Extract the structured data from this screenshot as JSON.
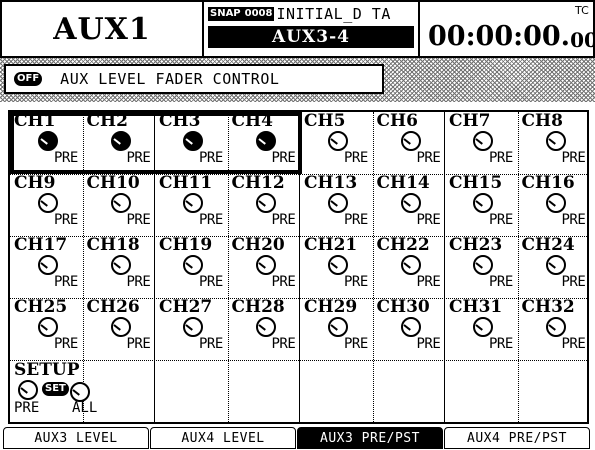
{
  "header": {
    "title": "AUX1",
    "snap_badge": "SNAP",
    "scene_number": "0008",
    "scene_name": "INITIAL_D TA",
    "aux_pair": "AUX3-4",
    "tc_label": "TC",
    "timecode": "00:00:00.",
    "timecode_frames": "00"
  },
  "fader_control": {
    "off_badge": "OFF",
    "label": "AUX LEVEL FADER CONTROL"
  },
  "channels": [
    {
      "name": "CH1",
      "pre": "PRE",
      "active": true
    },
    {
      "name": "CH2",
      "pre": "PRE",
      "active": true
    },
    {
      "name": "CH3",
      "pre": "PRE",
      "active": true
    },
    {
      "name": "CH4",
      "pre": "PRE",
      "active": true
    },
    {
      "name": "CH5",
      "pre": "PRE",
      "active": false
    },
    {
      "name": "CH6",
      "pre": "PRE",
      "active": false
    },
    {
      "name": "CH7",
      "pre": "PRE",
      "active": false
    },
    {
      "name": "CH8",
      "pre": "PRE",
      "active": false
    },
    {
      "name": "CH9",
      "pre": "PRE",
      "active": false
    },
    {
      "name": "CH10",
      "pre": "PRE",
      "active": false
    },
    {
      "name": "CH11",
      "pre": "PRE",
      "active": false
    },
    {
      "name": "CH12",
      "pre": "PRE",
      "active": false
    },
    {
      "name": "CH13",
      "pre": "PRE",
      "active": false
    },
    {
      "name": "CH14",
      "pre": "PRE",
      "active": false
    },
    {
      "name": "CH15",
      "pre": "PRE",
      "active": false
    },
    {
      "name": "CH16",
      "pre": "PRE",
      "active": false
    },
    {
      "name": "CH17",
      "pre": "PRE",
      "active": false
    },
    {
      "name": "CH18",
      "pre": "PRE",
      "active": false
    },
    {
      "name": "CH19",
      "pre": "PRE",
      "active": false
    },
    {
      "name": "CH20",
      "pre": "PRE",
      "active": false
    },
    {
      "name": "CH21",
      "pre": "PRE",
      "active": false
    },
    {
      "name": "CH22",
      "pre": "PRE",
      "active": false
    },
    {
      "name": "CH23",
      "pre": "PRE",
      "active": false
    },
    {
      "name": "CH24",
      "pre": "PRE",
      "active": false
    },
    {
      "name": "CH25",
      "pre": "PRE",
      "active": false
    },
    {
      "name": "CH26",
      "pre": "PRE",
      "active": false
    },
    {
      "name": "CH27",
      "pre": "PRE",
      "active": false
    },
    {
      "name": "CH28",
      "pre": "PRE",
      "active": false
    },
    {
      "name": "CH29",
      "pre": "PRE",
      "active": false
    },
    {
      "name": "CH30",
      "pre": "PRE",
      "active": false
    },
    {
      "name": "CH31",
      "pre": "PRE",
      "active": false
    },
    {
      "name": "CH32",
      "pre": "PRE",
      "active": false
    }
  ],
  "setup": {
    "label": "SETUP",
    "set_badge": "SET",
    "pre_label": "PRE",
    "all_label": "ALL"
  },
  "tabs": [
    {
      "label": "AUX3 LEVEL",
      "active": false
    },
    {
      "label": "AUX4 LEVEL",
      "active": false
    },
    {
      "label": "AUX3 PRE/PST",
      "active": true
    },
    {
      "label": "AUX4 PRE/PST",
      "active": false
    }
  ]
}
